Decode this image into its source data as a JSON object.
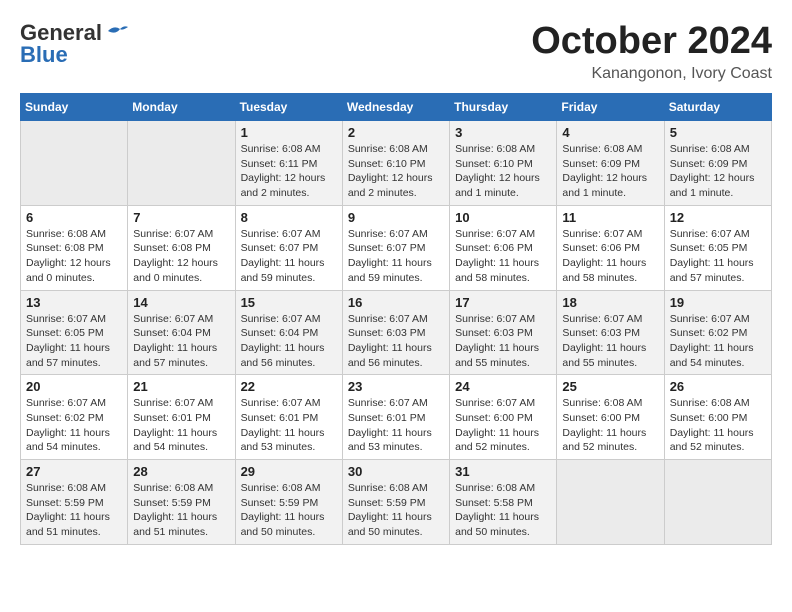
{
  "header": {
    "logo_line1": "General",
    "logo_line2": "Blue",
    "month": "October 2024",
    "location": "Kanangonon, Ivory Coast"
  },
  "weekdays": [
    "Sunday",
    "Monday",
    "Tuesday",
    "Wednesday",
    "Thursday",
    "Friday",
    "Saturday"
  ],
  "weeks": [
    [
      {
        "day": "",
        "detail": ""
      },
      {
        "day": "",
        "detail": ""
      },
      {
        "day": "1",
        "detail": "Sunrise: 6:08 AM\nSunset: 6:11 PM\nDaylight: 12 hours\nand 2 minutes."
      },
      {
        "day": "2",
        "detail": "Sunrise: 6:08 AM\nSunset: 6:10 PM\nDaylight: 12 hours\nand 2 minutes."
      },
      {
        "day": "3",
        "detail": "Sunrise: 6:08 AM\nSunset: 6:10 PM\nDaylight: 12 hours\nand 1 minute."
      },
      {
        "day": "4",
        "detail": "Sunrise: 6:08 AM\nSunset: 6:09 PM\nDaylight: 12 hours\nand 1 minute."
      },
      {
        "day": "5",
        "detail": "Sunrise: 6:08 AM\nSunset: 6:09 PM\nDaylight: 12 hours\nand 1 minute."
      }
    ],
    [
      {
        "day": "6",
        "detail": "Sunrise: 6:08 AM\nSunset: 6:08 PM\nDaylight: 12 hours\nand 0 minutes."
      },
      {
        "day": "7",
        "detail": "Sunrise: 6:07 AM\nSunset: 6:08 PM\nDaylight: 12 hours\nand 0 minutes."
      },
      {
        "day": "8",
        "detail": "Sunrise: 6:07 AM\nSunset: 6:07 PM\nDaylight: 11 hours\nand 59 minutes."
      },
      {
        "day": "9",
        "detail": "Sunrise: 6:07 AM\nSunset: 6:07 PM\nDaylight: 11 hours\nand 59 minutes."
      },
      {
        "day": "10",
        "detail": "Sunrise: 6:07 AM\nSunset: 6:06 PM\nDaylight: 11 hours\nand 58 minutes."
      },
      {
        "day": "11",
        "detail": "Sunrise: 6:07 AM\nSunset: 6:06 PM\nDaylight: 11 hours\nand 58 minutes."
      },
      {
        "day": "12",
        "detail": "Sunrise: 6:07 AM\nSunset: 6:05 PM\nDaylight: 11 hours\nand 57 minutes."
      }
    ],
    [
      {
        "day": "13",
        "detail": "Sunrise: 6:07 AM\nSunset: 6:05 PM\nDaylight: 11 hours\nand 57 minutes."
      },
      {
        "day": "14",
        "detail": "Sunrise: 6:07 AM\nSunset: 6:04 PM\nDaylight: 11 hours\nand 57 minutes."
      },
      {
        "day": "15",
        "detail": "Sunrise: 6:07 AM\nSunset: 6:04 PM\nDaylight: 11 hours\nand 56 minutes."
      },
      {
        "day": "16",
        "detail": "Sunrise: 6:07 AM\nSunset: 6:03 PM\nDaylight: 11 hours\nand 56 minutes."
      },
      {
        "day": "17",
        "detail": "Sunrise: 6:07 AM\nSunset: 6:03 PM\nDaylight: 11 hours\nand 55 minutes."
      },
      {
        "day": "18",
        "detail": "Sunrise: 6:07 AM\nSunset: 6:03 PM\nDaylight: 11 hours\nand 55 minutes."
      },
      {
        "day": "19",
        "detail": "Sunrise: 6:07 AM\nSunset: 6:02 PM\nDaylight: 11 hours\nand 54 minutes."
      }
    ],
    [
      {
        "day": "20",
        "detail": "Sunrise: 6:07 AM\nSunset: 6:02 PM\nDaylight: 11 hours\nand 54 minutes."
      },
      {
        "day": "21",
        "detail": "Sunrise: 6:07 AM\nSunset: 6:01 PM\nDaylight: 11 hours\nand 54 minutes."
      },
      {
        "day": "22",
        "detail": "Sunrise: 6:07 AM\nSunset: 6:01 PM\nDaylight: 11 hours\nand 53 minutes."
      },
      {
        "day": "23",
        "detail": "Sunrise: 6:07 AM\nSunset: 6:01 PM\nDaylight: 11 hours\nand 53 minutes."
      },
      {
        "day": "24",
        "detail": "Sunrise: 6:07 AM\nSunset: 6:00 PM\nDaylight: 11 hours\nand 52 minutes."
      },
      {
        "day": "25",
        "detail": "Sunrise: 6:08 AM\nSunset: 6:00 PM\nDaylight: 11 hours\nand 52 minutes."
      },
      {
        "day": "26",
        "detail": "Sunrise: 6:08 AM\nSunset: 6:00 PM\nDaylight: 11 hours\nand 52 minutes."
      }
    ],
    [
      {
        "day": "27",
        "detail": "Sunrise: 6:08 AM\nSunset: 5:59 PM\nDaylight: 11 hours\nand 51 minutes."
      },
      {
        "day": "28",
        "detail": "Sunrise: 6:08 AM\nSunset: 5:59 PM\nDaylight: 11 hours\nand 51 minutes."
      },
      {
        "day": "29",
        "detail": "Sunrise: 6:08 AM\nSunset: 5:59 PM\nDaylight: 11 hours\nand 50 minutes."
      },
      {
        "day": "30",
        "detail": "Sunrise: 6:08 AM\nSunset: 5:59 PM\nDaylight: 11 hours\nand 50 minutes."
      },
      {
        "day": "31",
        "detail": "Sunrise: 6:08 AM\nSunset: 5:58 PM\nDaylight: 11 hours\nand 50 minutes."
      },
      {
        "day": "",
        "detail": ""
      },
      {
        "day": "",
        "detail": ""
      }
    ]
  ]
}
